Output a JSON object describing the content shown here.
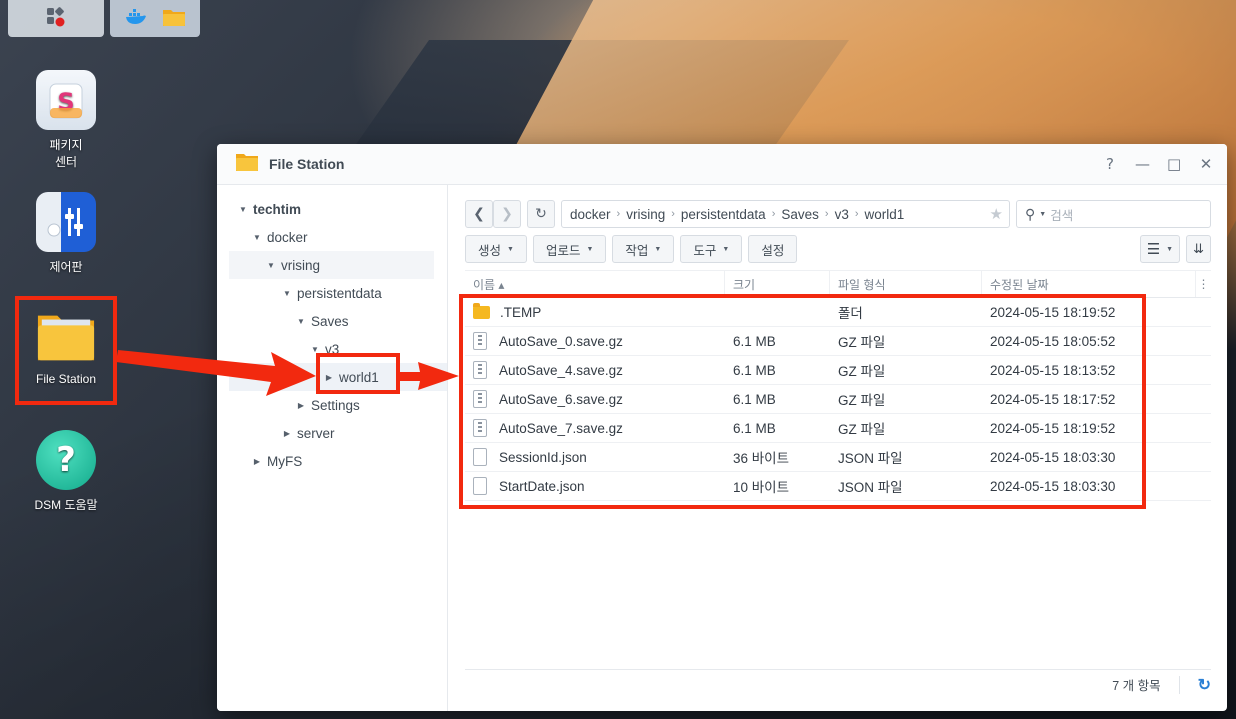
{
  "taskbar": {
    "apps_icon": "apps-grid-icon",
    "docker_icon": "docker-whale-icon",
    "folder_icon": "folder-icon"
  },
  "desktop": {
    "icons": [
      {
        "label_line1": "패키지",
        "label_line2": "센터",
        "icon": "package-center-icon"
      },
      {
        "label_line1": "제어판",
        "label_line2": "",
        "icon": "control-panel-icon"
      },
      {
        "label_line1": "File Station",
        "label_line2": "",
        "icon": "file-station-icon"
      },
      {
        "label_line1": "DSM 도움말",
        "label_line2": "",
        "icon": "help-icon"
      }
    ]
  },
  "window": {
    "title": "File Station",
    "controls": {
      "help": "?",
      "minimize": "—",
      "maximize": "□",
      "close": "✕"
    }
  },
  "sidebar": {
    "tree": [
      {
        "label": "techtim",
        "expanded": true
      },
      {
        "label": "docker",
        "expanded": true
      },
      {
        "label": "vrising",
        "expanded": true
      },
      {
        "label": "persistentdata",
        "expanded": true
      },
      {
        "label": "Saves",
        "expanded": true
      },
      {
        "label": "v3",
        "expanded": true
      },
      {
        "label": "world1",
        "expanded": false,
        "selected": true
      },
      {
        "label": "Settings",
        "expanded": false
      },
      {
        "label": "server",
        "expanded": false
      },
      {
        "label": "MyFS",
        "expanded": false
      }
    ]
  },
  "pathbar": {
    "segments": [
      "docker",
      "vrising",
      "persistentdata",
      "Saves",
      "v3",
      "world1"
    ]
  },
  "search": {
    "placeholder": "검색"
  },
  "actions": {
    "create": "생성",
    "upload": "업로드",
    "action": "작업",
    "tools": "도구",
    "settings": "설정"
  },
  "table": {
    "headers": {
      "name": "이름 ▴",
      "size": "크기",
      "type": "파일 형식",
      "modified": "수정된 날짜"
    },
    "rows": [
      {
        "name": ".TEMP",
        "size": "",
        "type": "폴더",
        "modified": "2024-05-15 18:19:52",
        "kind": "folder"
      },
      {
        "name": "AutoSave_0.save.gz",
        "size": "6.1 MB",
        "type": "GZ 파일",
        "modified": "2024-05-15 18:05:52",
        "kind": "gz"
      },
      {
        "name": "AutoSave_4.save.gz",
        "size": "6.1 MB",
        "type": "GZ 파일",
        "modified": "2024-05-15 18:13:52",
        "kind": "gz"
      },
      {
        "name": "AutoSave_6.save.gz",
        "size": "6.1 MB",
        "type": "GZ 파일",
        "modified": "2024-05-15 18:17:52",
        "kind": "gz"
      },
      {
        "name": "AutoSave_7.save.gz",
        "size": "6.1 MB",
        "type": "GZ 파일",
        "modified": "2024-05-15 18:19:52",
        "kind": "gz"
      },
      {
        "name": "SessionId.json",
        "size": "36 바이트",
        "type": "JSON 파일",
        "modified": "2024-05-15 18:03:30",
        "kind": "file"
      },
      {
        "name": "StartDate.json",
        "size": "10 바이트",
        "type": "JSON 파일",
        "modified": "2024-05-15 18:03:30",
        "kind": "file"
      }
    ]
  },
  "status": {
    "item_count": "7 개 항목"
  },
  "colors": {
    "highlight": "#f2290f",
    "folder": "#f5b820",
    "refresh": "#2a7fd4"
  }
}
